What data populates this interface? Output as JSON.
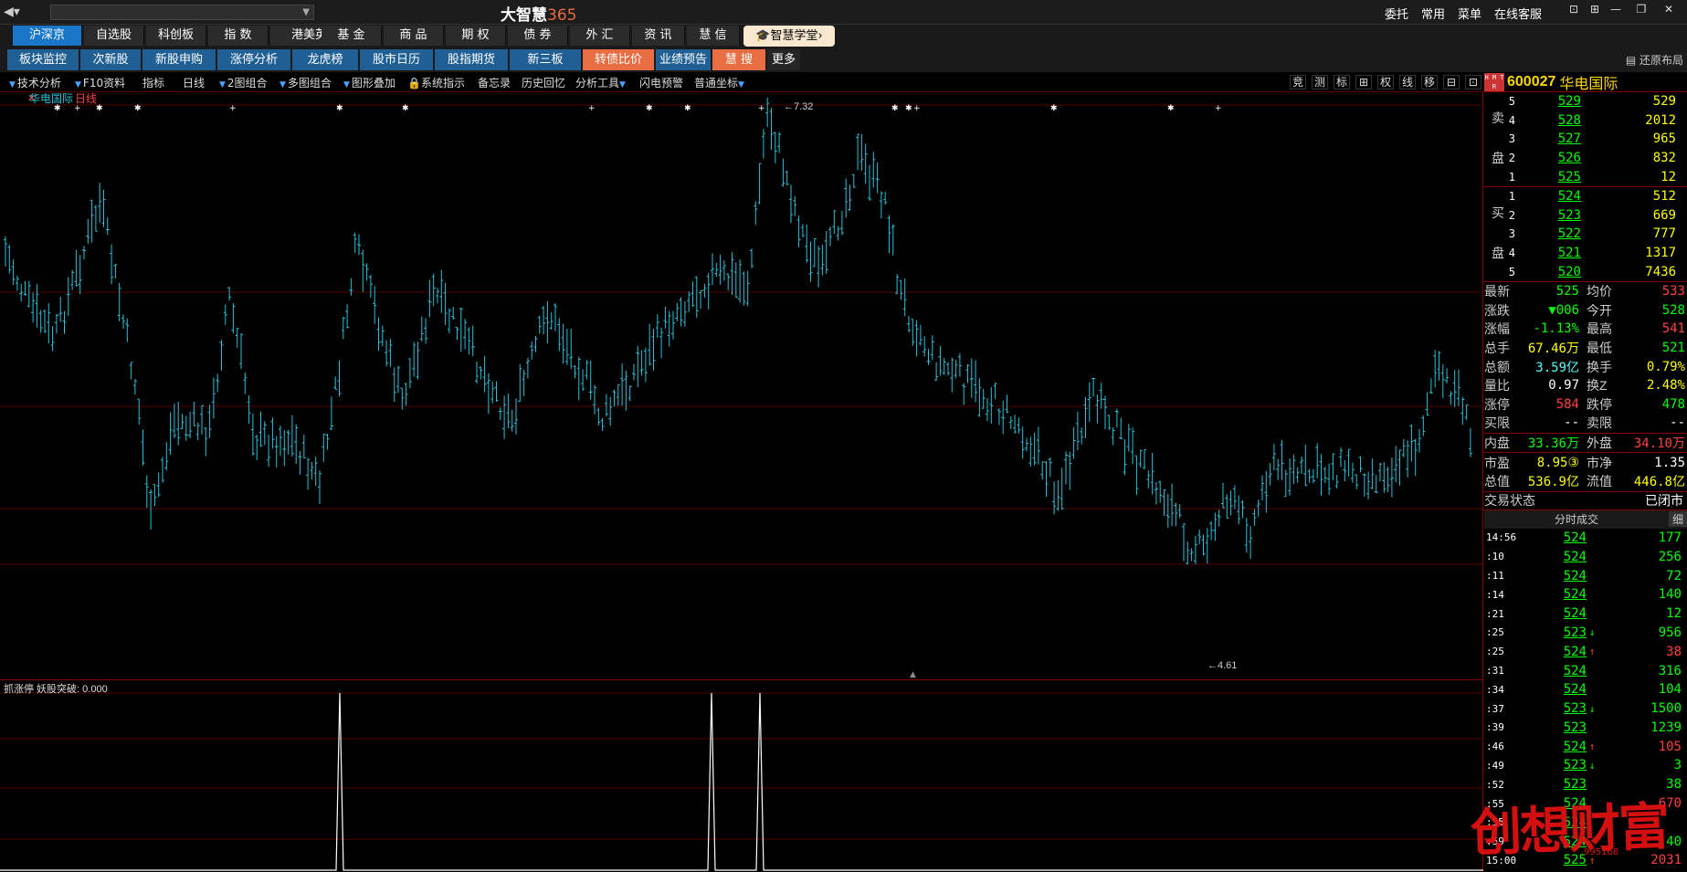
{
  "titlebar": {
    "app_title": "大智慧",
    "app_title_num": "365",
    "menu": [
      "委托",
      "常用",
      "菜单",
      "在线客服"
    ]
  },
  "market_tabs": [
    "沪深京",
    "自选股",
    "科创板",
    "指 数",
    "港美英",
    "基 金",
    "商 品",
    "期 权",
    "债 券",
    "外 汇",
    "资 讯",
    "慧 信"
  ],
  "academy_label": "智慧学堂",
  "func_tabs": [
    "板块监控",
    "次新股",
    "新股申购",
    "涨停分析",
    "龙虎榜",
    "股市日历",
    "股指期货",
    "新三板",
    "转债比价",
    "业绩预告",
    "慧 搜",
    "更多"
  ],
  "restore_layout": "还原布局",
  "chart_toolbar": {
    "items": [
      "技术分析",
      "F10资料",
      "指标",
      "日线",
      "2图组合",
      "多图组合",
      "图形叠加",
      "系统指示",
      "备忘录",
      "历史回忆",
      "分析工具",
      "闪电预警",
      "普通坐标"
    ],
    "right_items": [
      "竞",
      "测",
      "标",
      "⊞",
      "权",
      "线",
      "移",
      "⊟",
      "⊡"
    ]
  },
  "main_chart": {
    "label_name": "华电国际",
    "label_period": "日线",
    "high_label": "7.32",
    "low_label": "4.61"
  },
  "indicator": {
    "label": "抓涨停 妖股突破: 0.000",
    "values": [
      0,
      1,
      1,
      1
    ]
  },
  "quote": {
    "hmtr": "H M T R",
    "code": "600027",
    "name": "华电国际",
    "sell_label": [
      "卖",
      "盘"
    ],
    "buy_label": [
      "买",
      "盘"
    ],
    "sell": [
      {
        "level": "5",
        "price": "529",
        "vol": "529"
      },
      {
        "level": "4",
        "price": "528",
        "vol": "2012"
      },
      {
        "level": "3",
        "price": "527",
        "vol": "965"
      },
      {
        "level": "2",
        "price": "526",
        "vol": "832"
      },
      {
        "level": "1",
        "price": "525",
        "vol": "12"
      }
    ],
    "buy": [
      {
        "level": "1",
        "price": "524",
        "vol": "512"
      },
      {
        "level": "2",
        "price": "523",
        "vol": "669"
      },
      {
        "level": "3",
        "price": "522",
        "vol": "777"
      },
      {
        "level": "4",
        "price": "521",
        "vol": "1317"
      },
      {
        "level": "5",
        "price": "520",
        "vol": "7436"
      }
    ],
    "stats1": [
      {
        "l1": "最新",
        "v1": "525",
        "c1": "c-g",
        "l2": "均价",
        "v2": "533",
        "c2": "c-r"
      },
      {
        "l1": "涨跌",
        "v1": "▼006",
        "c1": "c-g",
        "l2": "今开",
        "v2": "528",
        "c2": "c-g"
      },
      {
        "l1": "涨幅",
        "v1": "-1.13%",
        "c1": "c-g",
        "l2": "最高",
        "v2": "541",
        "c2": "c-r"
      },
      {
        "l1": "总手",
        "v1": "67.46万",
        "c1": "c-y",
        "l2": "最低",
        "v2": "521",
        "c2": "c-g"
      },
      {
        "l1": "总额",
        "v1": "3.59亿",
        "c1": "c-c",
        "l2": "换手",
        "v2": "0.79%",
        "c2": "c-y"
      },
      {
        "l1": "量比",
        "v1": "0.97",
        "c1": "c-w",
        "l2": "换Z",
        "v2": "2.48%",
        "c2": "c-y"
      },
      {
        "l1": "涨停",
        "v1": "584",
        "c1": "c-r",
        "l2": "跌停",
        "v2": "478",
        "c2": "c-g"
      },
      {
        "l1": "买限",
        "v1": "--",
        "c1": "c-w",
        "l2": "卖限",
        "v2": "--",
        "c2": "c-w"
      }
    ],
    "stats2": [
      {
        "l1": "内盘",
        "v1": "33.36万",
        "c1": "c-g",
        "l2": "外盘",
        "v2": "34.10万",
        "c2": "c-r"
      }
    ],
    "stats3": [
      {
        "l1": "市盈",
        "v1": "8.95③",
        "c1": "c-y",
        "l2": "市净",
        "v2": "1.35",
        "c2": "c-w"
      },
      {
        "l1": "总值",
        "v1": "536.9亿",
        "c1": "c-y",
        "l2": "流值",
        "v2": "446.8亿",
        "c2": "c-y"
      }
    ],
    "trade_status_label": "交易状态",
    "trade_status_value": "已闭市"
  },
  "ticks": {
    "header": "分时成交",
    "detail": "细",
    "rows": [
      {
        "t": "14:56",
        "p": "524",
        "a": "",
        "v": "177",
        "c": "c-g"
      },
      {
        "t": ":10",
        "p": "524",
        "a": "",
        "v": "256",
        "c": "c-g"
      },
      {
        "t": ":11",
        "p": "524",
        "a": "",
        "v": "72",
        "c": "c-g"
      },
      {
        "t": ":14",
        "p": "524",
        "a": "",
        "v": "140",
        "c": "c-g"
      },
      {
        "t": ":21",
        "p": "524",
        "a": "",
        "v": "12",
        "c": "c-g"
      },
      {
        "t": ":25",
        "p": "523",
        "a": "down",
        "v": "956",
        "c": "c-g"
      },
      {
        "t": ":25",
        "p": "524",
        "a": "up",
        "v": "38",
        "c": "c-r"
      },
      {
        "t": ":31",
        "p": "524",
        "a": "",
        "v": "316",
        "c": "c-g"
      },
      {
        "t": ":34",
        "p": "524",
        "a": "",
        "v": "104",
        "c": "c-g"
      },
      {
        "t": ":37",
        "p": "523",
        "a": "down",
        "v": "1500",
        "c": "c-g"
      },
      {
        "t": ":39",
        "p": "523",
        "a": "",
        "v": "1239",
        "c": "c-g"
      },
      {
        "t": ":46",
        "p": "524",
        "a": "up",
        "v": "105",
        "c": "c-r"
      },
      {
        "t": ":49",
        "p": "523",
        "a": "down",
        "v": "3",
        "c": "c-g"
      },
      {
        "t": ":52",
        "p": "523",
        "a": "",
        "v": "38",
        "c": "c-g"
      },
      {
        "t": ":55",
        "p": "524",
        "a": "",
        "v": "670",
        "c": "c-r"
      },
      {
        "t": ":55",
        "p": "524",
        "a": "",
        "v": "",
        "c": "c-g"
      },
      {
        "t": ":59",
        "p": "524",
        "a": "",
        "v": "40",
        "c": "c-g"
      },
      {
        "t": "15:00",
        "p": "525",
        "a": "up",
        "v": "2031",
        "c": "c-r"
      }
    ]
  },
  "watermark": {
    "text": "创想财富",
    "sub": "995168"
  },
  "colors": {
    "candle": "#2ac2d8",
    "grid": "#5a0000",
    "accent": "#1976c9",
    "highlight": "#e86d43"
  }
}
